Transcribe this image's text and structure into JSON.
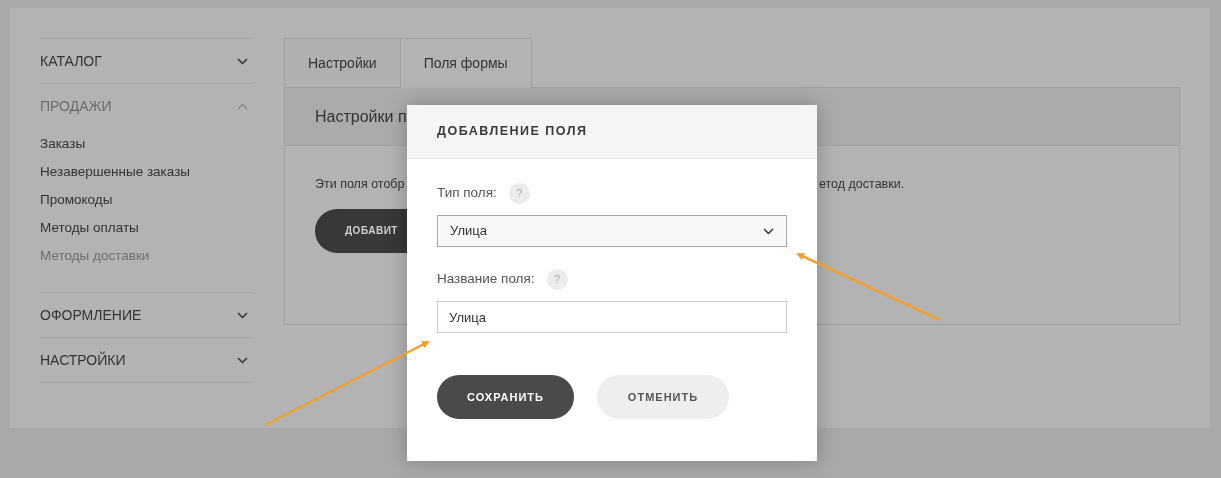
{
  "sidebar": [
    {
      "title": "КАТАЛОГ",
      "expanded": false
    },
    {
      "title": "ПРОДАЖИ",
      "expanded": true,
      "items": [
        {
          "label": "Заказы",
          "selected": false
        },
        {
          "label": "Незавершенные заказы",
          "selected": false
        },
        {
          "label": "Промокоды",
          "selected": false
        },
        {
          "label": "Методы оплаты",
          "selected": false
        },
        {
          "label": "Методы доставки",
          "selected": true
        }
      ]
    },
    {
      "title": "ОФОРМЛЕНИЕ",
      "expanded": false
    },
    {
      "title": "НАСТРОЙКИ",
      "expanded": false
    }
  ],
  "tabs": [
    {
      "label": "Настройки",
      "selected": false
    },
    {
      "label": "Поля формы",
      "selected": true
    }
  ],
  "panel": {
    "heading": "Настройки п",
    "description_start": "Эти поля отобр",
    "description_end": "етод доставки.",
    "add_button": "ДОБАВИТ"
  },
  "dialog": {
    "title": "ДОБАВЛЕНИЕ ПОЛЯ",
    "fields": [
      {
        "kind": "select",
        "label": "Тип поля:",
        "help": "?",
        "value": "Улица"
      },
      {
        "kind": "text",
        "label": "Название поля:",
        "help": "?",
        "value": "Улица"
      }
    ],
    "buttons": [
      {
        "kind": "primary",
        "label": "СОХРАНИТЬ"
      },
      {
        "kind": "secondary",
        "label": "ОТМЕНИТЬ"
      }
    ]
  }
}
